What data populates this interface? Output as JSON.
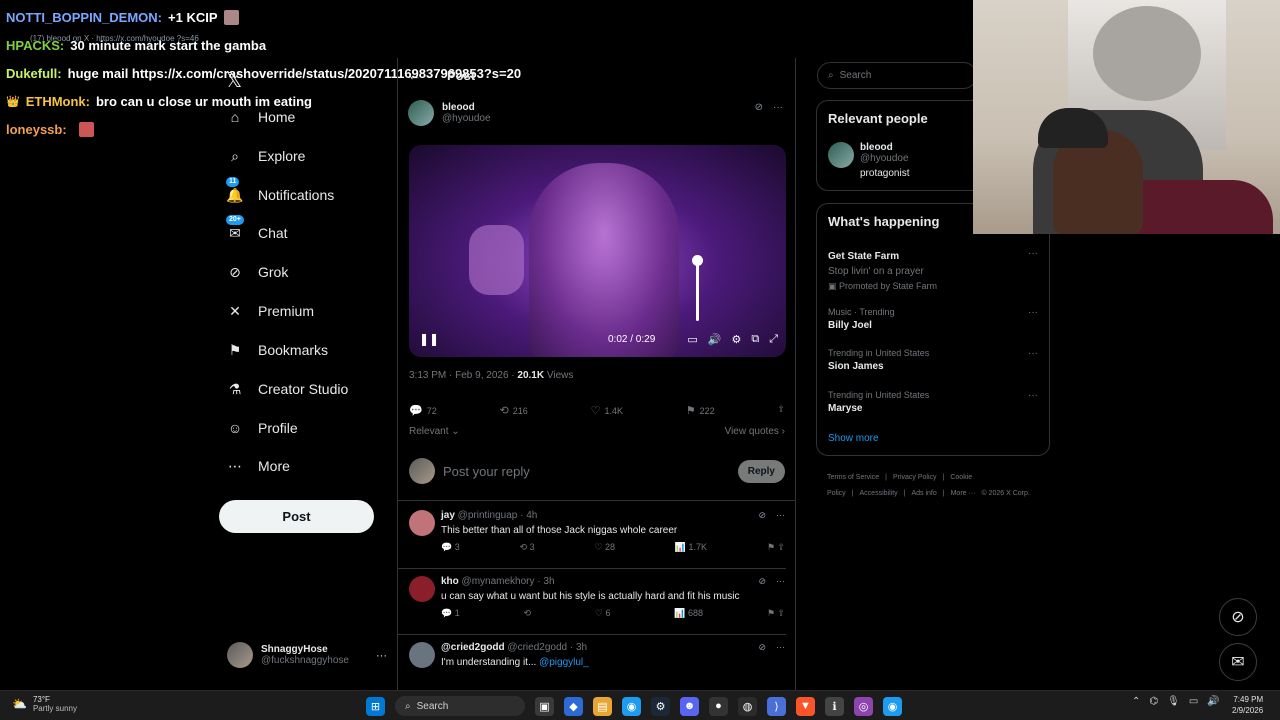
{
  "nav": {
    "logo": "𝕏",
    "items": [
      {
        "label": "Home",
        "icon": "home-icon",
        "glyph": "⌂"
      },
      {
        "label": "Explore",
        "icon": "search-icon",
        "glyph": "⌕"
      },
      {
        "label": "Notifications",
        "icon": "bell-icon",
        "glyph": "🔔",
        "badge": "11"
      },
      {
        "label": "Chat",
        "icon": "mail-icon",
        "glyph": "✉",
        "badge": "20+"
      },
      {
        "label": "Grok",
        "icon": "grok-icon",
        "glyph": "⊘"
      },
      {
        "label": "Premium",
        "icon": "x-icon",
        "glyph": "✕"
      },
      {
        "label": "Bookmarks",
        "icon": "bookmark-icon",
        "glyph": "⚑"
      },
      {
        "label": "Creator Studio",
        "icon": "flask-icon",
        "glyph": "⚗"
      },
      {
        "label": "Profile",
        "icon": "person-icon",
        "glyph": "☺"
      },
      {
        "label": "More",
        "icon": "more-circle-icon",
        "glyph": "⋯"
      }
    ],
    "post_label": "Post",
    "account": {
      "name": "ShnaggyHose",
      "handle": "@fuckshnaggyhose",
      "more": "···"
    }
  },
  "post": {
    "header_title": "Post",
    "author_name": "bleood",
    "author_handle": "@hyoudoe",
    "video_time": "0:02 / 0:29",
    "volume_level": 0.95,
    "timestamp": "3:13 PM · Feb 9, 2026 · ",
    "views_count": "20.1K",
    "views_label": " Views",
    "stats": {
      "replies": "72",
      "reposts": "216",
      "likes": "1.4K",
      "bookmarks": "222"
    },
    "sort_label": "Relevant ⌄",
    "view_quotes": "View quotes ›",
    "reply_placeholder": "Post your reply",
    "reply_button": "Reply"
  },
  "replies": [
    {
      "name": "jay",
      "meta": " @printinguap · 4h",
      "text": "This better than all of those Jack niggas whole career",
      "link": "",
      "replies": "3",
      "reposts": "3",
      "likes": "28",
      "views": "1.7K",
      "avatar": "#c0747a"
    },
    {
      "name": "kho",
      "meta": " @mynamekhory · 3h",
      "text": "u can say what u want but his style is actually hard and fit his music",
      "link": "",
      "replies": "1",
      "reposts": "",
      "likes": "6",
      "views": "688",
      "avatar": "#8a1e2a"
    },
    {
      "name": "@cried2godd",
      "meta": " @cried2godd · 3h",
      "text": "I'm understanding it... ",
      "link": "@piggylul_",
      "replies": "",
      "reposts": "",
      "likes": "",
      "views": "",
      "avatar": "#6a7380"
    }
  ],
  "right": {
    "search_placeholder": "Search",
    "relevant_title": "Relevant people",
    "relevant": {
      "name": "bleood",
      "handle": "@hyoudoe",
      "bio": "protagonist"
    },
    "happening_title": "What's happening",
    "trends": [
      {
        "context": "",
        "title": "Get State Farm",
        "sub": "Stop livin' on a prayer",
        "promo": "Promoted by State Farm"
      },
      {
        "context": "Music · Trending",
        "title": "Billy Joel",
        "sub": "",
        "promo": ""
      },
      {
        "context": "Trending in United States",
        "title": "Sion James",
        "sub": "",
        "promo": ""
      },
      {
        "context": "Trending in United States",
        "title": "Maryse",
        "sub": "",
        "promo": ""
      }
    ],
    "show_more": "Show more",
    "footer_links": [
      "Terms of Service",
      "|",
      "Privacy Policy",
      "|",
      "Cookie Policy",
      "|",
      "Accessibility",
      "|",
      "Ads info",
      "|",
      "More ···",
      "© 2026 X Corp."
    ]
  },
  "chat": [
    {
      "user": "NOTTI_BOPPIN_DEMON:",
      "color": "#7aa7ff",
      "msg": " +1 KCIP"
    },
    {
      "user": "HPACKS:",
      "color": "#7fd23d",
      "msg": " 30 minute mark start the gamba"
    },
    {
      "user": "Dukefull:",
      "color": "#c9f266",
      "msg": " huge mail https://x.com/crashoverride/status/2020711169837969853?s=20"
    },
    {
      "user": "ETHMonk:",
      "color": "#f5c542",
      "msg": " bro can u close ur mouth im eating",
      "crown": "👑"
    },
    {
      "user": "loneyssb:",
      "color": "#f0a050",
      "msg": ""
    }
  ],
  "url_ghost": "(17) bleood on X · https://x.com/hyoudoe ?s=46",
  "taskbar": {
    "temp": "73°F",
    "condition": "Partly sunny",
    "search": "Search",
    "time": "7:49 PM",
    "date": "2/9/2026"
  }
}
